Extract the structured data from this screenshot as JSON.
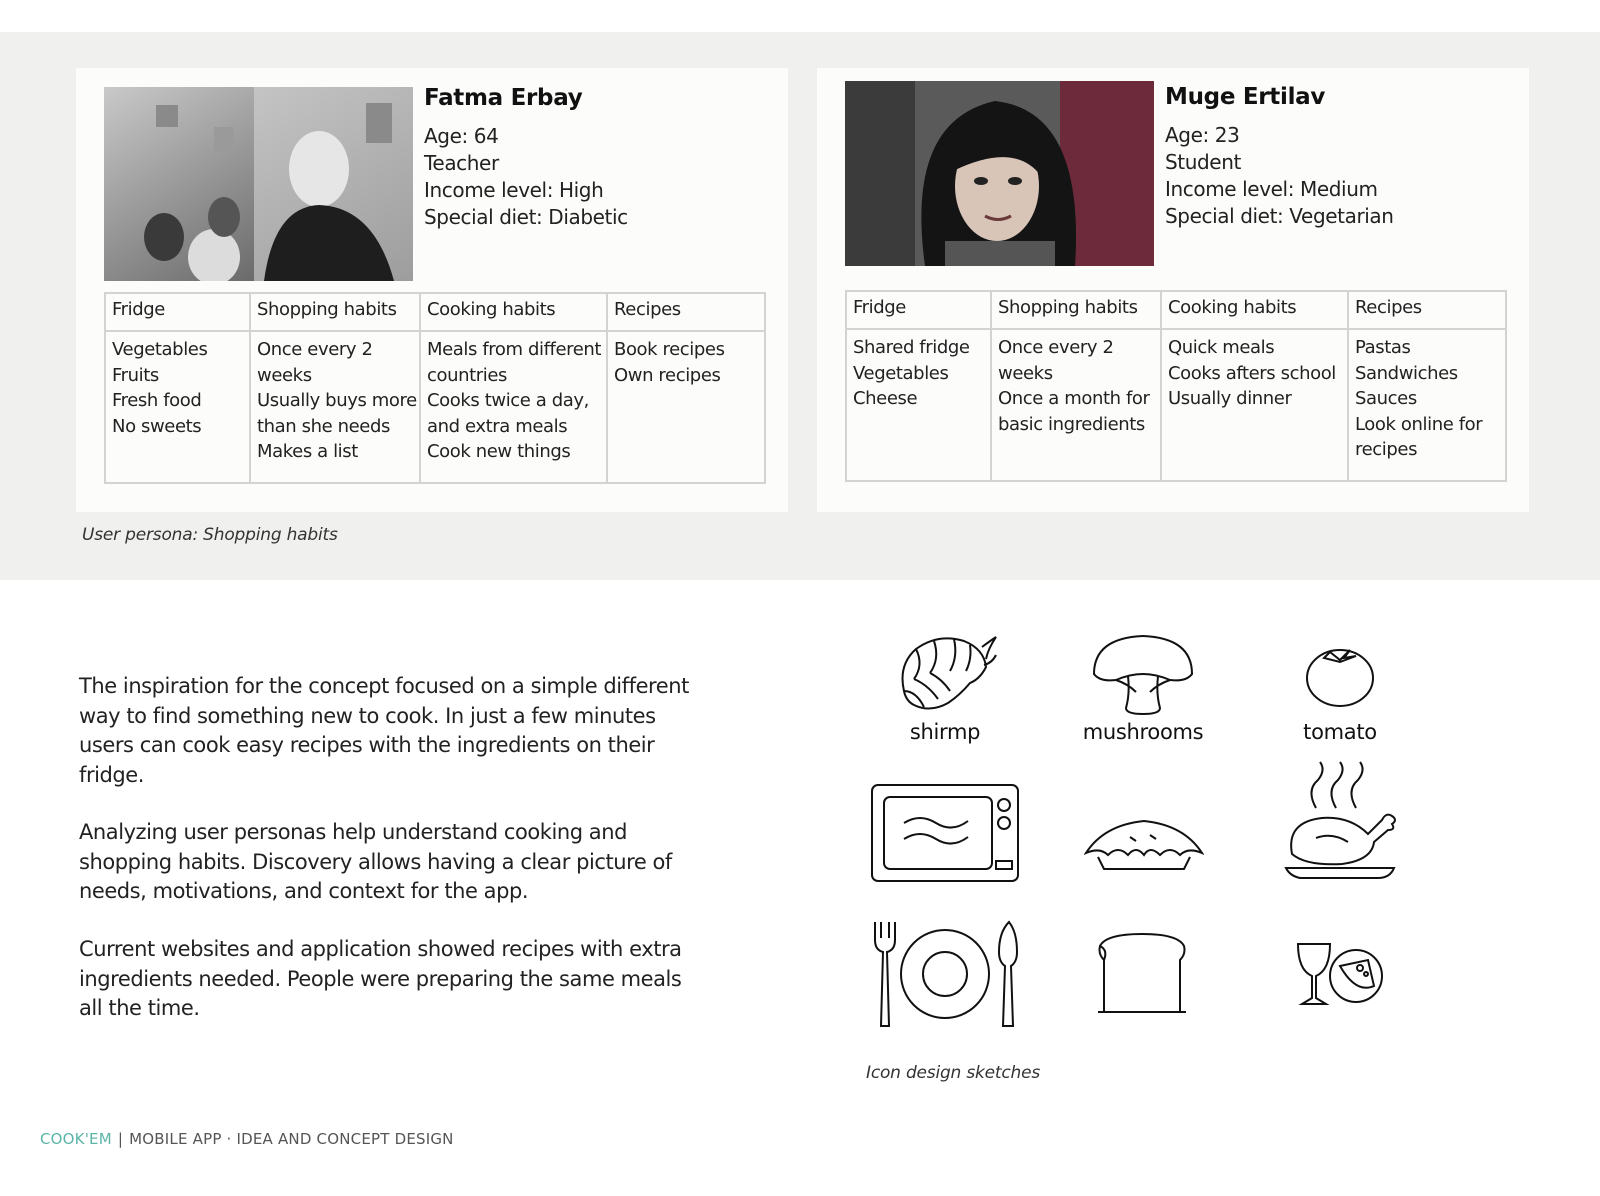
{
  "personas": [
    {
      "name": "Fatma Erbay",
      "details": [
        "Age: 64",
        "Teacher",
        "Income level: High",
        "Special diet: Diabetic"
      ],
      "table_headers": [
        "Fridge",
        "Shopping habits",
        "Cooking habits",
        "Recipes"
      ],
      "table_cells": [
        [
          "Vegetables",
          "Fruits",
          "Fresh food",
          "No sweets"
        ],
        [
          "Once every 2",
          "weeks",
          "Usually buys more",
          "than she needs",
          "Makes a list"
        ],
        [
          "Meals from different",
          "countries",
          "Cooks twice a day,",
          "and extra meals",
          "Cook new things"
        ],
        [
          "Book recipes",
          "Own recipes"
        ]
      ]
    },
    {
      "name": "Muge Ertilav",
      "details": [
        "Age: 23",
        "Student",
        "Income level: Medium",
        "Special diet: Vegetarian"
      ],
      "table_headers": [
        "Fridge",
        "Shopping habits",
        "Cooking habits",
        "Recipes"
      ],
      "table_cells": [
        [
          "Shared fridge",
          "Vegetables",
          "Cheese"
        ],
        [
          "Once every 2",
          "weeks",
          "Once a month for",
          "basic ingredients"
        ],
        [
          "Quick meals",
          "Cooks afters school",
          "Usually dinner"
        ],
        [
          "Pastas",
          "Sandwiches",
          "Sauces",
          "Look online for",
          "recipes"
        ]
      ]
    }
  ],
  "personas_caption": "User persona: Shopping habits",
  "paragraphs": [
    [
      "The inspiration for the concept focused on a simple different",
      "way to find something new to cook. In just a few minutes",
      "users can cook easy recipes with the ingredients on their",
      "fridge."
    ],
    [
      "Analyzing user personas help understand cooking and",
      "shopping habits. Discovery allows having a  clear picture of",
      "needs, motivations, and context for the app."
    ],
    [
      "Current websites and application showed recipes with extra",
      "ingredients needed.  People were preparing the same meals",
      "all the time."
    ]
  ],
  "icons": {
    "labels": [
      "shirmp",
      "mushrooms",
      "tomato"
    ],
    "names": [
      "shrimp-icon",
      "mushroom-icon",
      "tomato-icon",
      "microwave-icon",
      "pie-icon",
      "roast-chicken-icon",
      "cutlery-plate-icon",
      "bread-icon",
      "wine-cheese-icon"
    ]
  },
  "icons_caption": "Icon design sketches",
  "footer": {
    "brand": "COOK'EM",
    "separator": "|",
    "subtitle": "MOBILE APP · IDEA AND CONCEPT DESIGN"
  },
  "colors": {
    "brand": "#5bb5a8",
    "band": "#f0f0ef",
    "table_border": "#d3d3d3"
  }
}
